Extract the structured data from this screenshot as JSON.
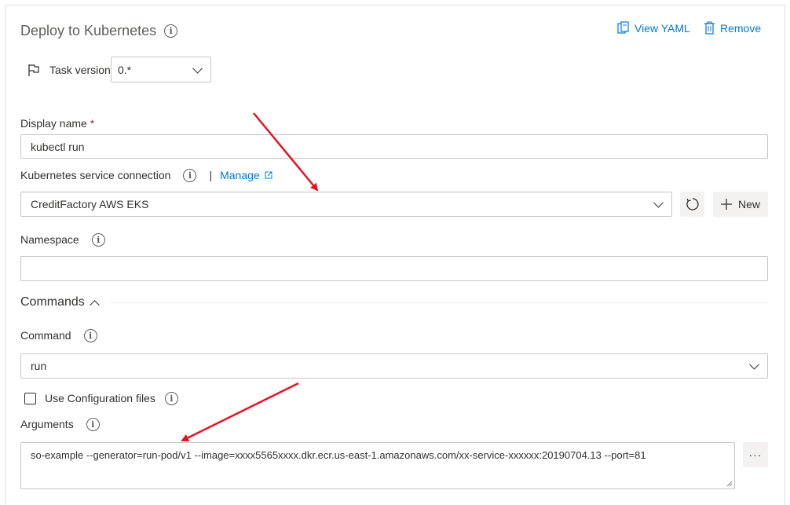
{
  "header": {
    "title": "Deploy to Kubernetes",
    "view_yaml_label": "View YAML",
    "remove_label": "Remove"
  },
  "task_version": {
    "label": "Task version",
    "value": "0.*"
  },
  "display_name": {
    "label": "Display name",
    "required_mark": "*",
    "value": "kubectl run"
  },
  "service_connection": {
    "label": "Kubernetes service connection",
    "separator": "|",
    "manage_label": "Manage",
    "value": "CreditFactory AWS EKS",
    "new_label": "New"
  },
  "namespace": {
    "label": "Namespace",
    "value": ""
  },
  "commands_section": {
    "title": "Commands"
  },
  "command": {
    "label": "Command",
    "value": "run"
  },
  "use_config_files": {
    "label": "Use Configuration files",
    "checked": false
  },
  "arguments": {
    "label": "Arguments",
    "value": "so-example --generator=run-pod/v1 --image=xxxx5565xxxx.dkr.ecr.us-east-1.amazonaws.com/xx-service-xxxxxx:20190704.13 --port=81",
    "more_label": "···"
  },
  "colors": {
    "link": "#0078d4",
    "annotation_arrow": "#e81123",
    "required": "#a4262c",
    "border": "#c8c6c4"
  }
}
